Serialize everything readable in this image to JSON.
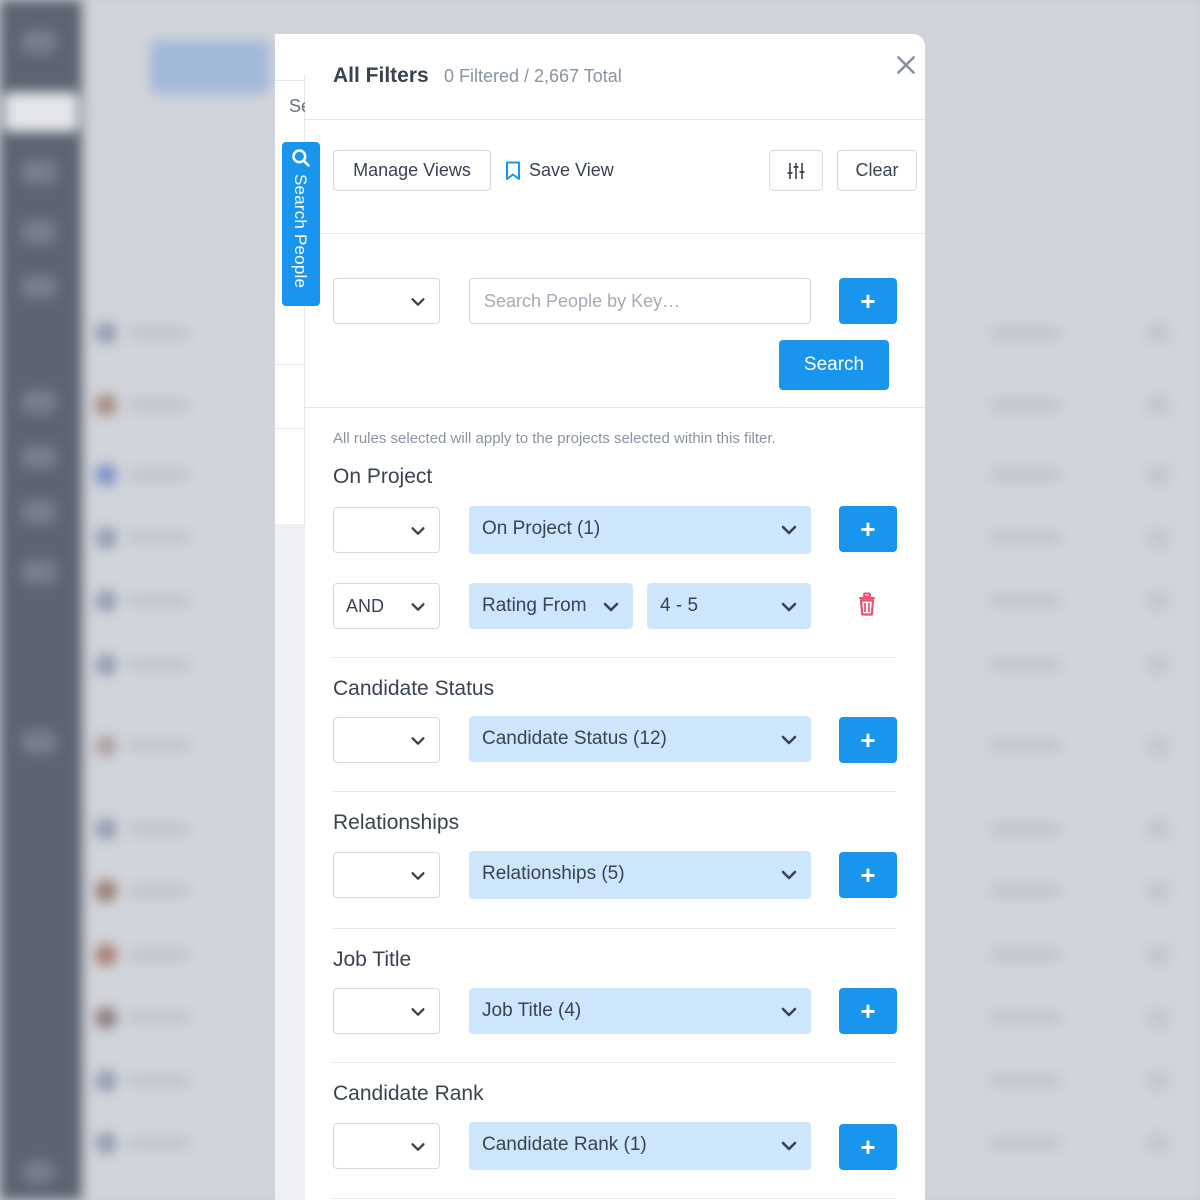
{
  "side_panel": {
    "search_prefix": "Se",
    "search_tab_label": "Search People"
  },
  "modal": {
    "title": "All Filters",
    "count_text": "0 Filtered / 2,667 Total",
    "toolbar": {
      "manage_views": "Manage Views",
      "save_view": "Save View",
      "clear": "Clear"
    },
    "search": {
      "placeholder": "Search People by Key…",
      "search_button": "Search",
      "plus": "+"
    },
    "note": "All rules selected will apply to the projects selected within this filter.",
    "sections": {
      "on_project": {
        "title": "On Project",
        "value": "On Project (1)",
        "rule_operator": "AND",
        "rule_field": "Rating From",
        "rule_value": "4 - 5"
      },
      "candidate_status": {
        "title": "Candidate Status",
        "value": "Candidate Status (12)"
      },
      "relationships": {
        "title": "Relationships",
        "value": "Relationships (5)"
      },
      "job_title": {
        "title": "Job Title",
        "value": "Job Title (4)"
      },
      "candidate_rank": {
        "title": "Candidate Rank",
        "value": "Candidate Rank (1)"
      }
    }
  },
  "colors": {
    "accent": "#1a95ee",
    "select_fill": "#cde6fb",
    "danger": "#f0506e",
    "text": "#3a4350",
    "muted": "#8a93a0"
  }
}
